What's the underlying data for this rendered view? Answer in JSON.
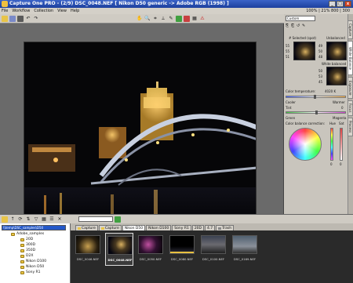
{
  "window": {
    "title": "Capture One PRO - (2/9) DSC_0048.NEF [ Nikon D50 generic -> Adobe RGB (1998) ]",
    "buttons": [
      "_",
      "□",
      "x"
    ]
  },
  "menu": {
    "items": [
      "File",
      "Workflow",
      "Collection",
      "View",
      "Help"
    ],
    "status": "100% | 21%     800 | 300"
  },
  "toolbar": {
    "icons": [
      "open-icon",
      "save-icon",
      "capture-icon",
      "rotate-left-icon",
      "rotate-right-icon",
      "hand-icon",
      "zoom-icon",
      "crop-icon",
      "straighten-icon",
      "picker-icon",
      "loupe-icon",
      "compare-icon",
      "grid-icon",
      "warning-icon"
    ]
  },
  "right_panel": {
    "preset": "Custom",
    "vertical_tabs": [
      "Capture",
      "White Balance",
      "Exposure",
      "Focus",
      "Process"
    ],
    "wb": {
      "selected_label": "# Selected (spot)",
      "unbalanced_label": "Unbalanced",
      "white_balanced_label": "White balanced",
      "r": "55",
      "g": "55",
      "b": "51",
      "r2": "49",
      "g2": "50",
      "b2": "48",
      "r3": "50",
      "g3": "53",
      "b3": "45"
    },
    "color_temp": {
      "label": "Color temperature:",
      "value": "4020 K"
    },
    "cool_label": "Cooler",
    "warm_label": "Warmer",
    "tint_label": "Tint",
    "tint_value": "0",
    "green_label": "Green",
    "magenta_label": "Magenta",
    "cb_label": "Color balance correction:",
    "hue_label": "Hue",
    "sat_label": "Sat",
    "hue_value": "0",
    "sat_value": "0"
  },
  "browser": {
    "path": "\\\\temp\\DSC_samples\\D50",
    "tree": [
      "Adobe_samples",
      "20D",
      "300D",
      "350D",
      "D2X",
      "Nikon D100",
      "Nikon D50",
      "Sony R1"
    ],
    "tabs": [
      "Capture",
      "Capture",
      "Nikon D50",
      "Nikon D100",
      "Sony R1",
      "20D",
      "4.7",
      "Trash"
    ],
    "active_tab": 2,
    "thumbs": [
      {
        "name": "DSC_0046.NEF",
        "selected": false
      },
      {
        "name": "DSC_0048.NEF",
        "selected": true
      },
      {
        "name": "DSC_0050.NEF",
        "selected": false
      },
      {
        "name": "DSC_0080.NEF",
        "selected": false
      },
      {
        "name": "DSC_0100.NEF",
        "selected": false
      },
      {
        "name": "DSC_0169.NEF",
        "selected": false
      }
    ]
  },
  "colors": {
    "titlebar": "#2448a8",
    "selection": "#2458c8",
    "viewer_bg": "#6a6a6a"
  }
}
